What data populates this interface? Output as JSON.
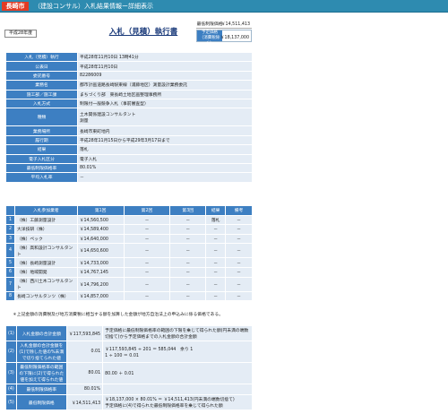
{
  "header": {
    "city": "長崎市",
    "title": "（建設コンサル）入札結果情報ー詳細表示"
  },
  "era": "平成28年度",
  "doc_title": "入札（見積）執行書",
  "min_price": {
    "label": "最低制限価格",
    "value": "￥14,511,413"
  },
  "est_price": {
    "label1": "予定価格",
    "label2": "（消費税除く）",
    "value": "￥18,137,000"
  },
  "info": [
    {
      "k": "入札（見積）執行",
      "v": "平成28年11月10日 13時41分"
    },
    {
      "k": "公表日",
      "v": "平成28年11月10日"
    },
    {
      "k": "委託番号",
      "v": "82286009"
    },
    {
      "k": "業務名",
      "v": "都市計画道路長崎駅東線（浦藤地区）測量設計業務委託"
    },
    {
      "k": "施工部／施工課",
      "v": "まちづくり部　東長崎土地区画整理事務所"
    },
    {
      "k": "入札方式",
      "v": "制限付一般競争入札（事前審査型）"
    },
    {
      "k": "種類",
      "v": "土木関係建設コンサルタント",
      "v2": "測量"
    },
    {
      "k": "業務場所",
      "v": "長崎市東町地内"
    },
    {
      "k": "履行期",
      "v": "平成28年11月15日から平成29年3月17日まで"
    },
    {
      "k": "結果",
      "v": "落札"
    },
    {
      "k": "電子入札区分",
      "v": "電子入札"
    },
    {
      "k": "最低制限価格率",
      "v": "80.01%"
    },
    {
      "k": "平均入札率",
      "v": "－"
    }
  ],
  "bid_headers": [
    "入札参加業者",
    "第1回",
    "第2回",
    "第3回",
    "結果",
    "備考"
  ],
  "bidders": [
    {
      "no": "1",
      "name": "（株）工藤測量設計",
      "r1": "￥14,560,500",
      "r2": "－",
      "r3": "－",
      "res": "落札",
      "memo": "－"
    },
    {
      "no": "2",
      "name": "大洋技研（株）",
      "r1": "￥14,589,400",
      "r2": "－",
      "r3": "－",
      "res": "－",
      "memo": "－"
    },
    {
      "no": "3",
      "name": "（株）ペック",
      "r1": "￥14,640,000",
      "r2": "－",
      "r3": "－",
      "res": "－",
      "memo": "－"
    },
    {
      "no": "4",
      "name": "（株）高和設計コンサルタント",
      "r1": "￥14,650,600",
      "r2": "－",
      "r3": "－",
      "res": "－",
      "memo": "－"
    },
    {
      "no": "5",
      "name": "（株）長崎測量設計",
      "r1": "￥14,733,000",
      "r2": "－",
      "r3": "－",
      "res": "－",
      "memo": "－"
    },
    {
      "no": "6",
      "name": "（株）地域開発",
      "r1": "￥14,767,145",
      "r2": "－",
      "r3": "－",
      "res": "－",
      "memo": "－"
    },
    {
      "no": "7",
      "name": "（株）西川土木コンサルタント",
      "r1": "￥14,796,200",
      "r2": "－",
      "r3": "－",
      "res": "－",
      "memo": "－"
    },
    {
      "no": "8",
      "name": "長崎コンサルタンツ（株）",
      "r1": "￥14,857,000",
      "r2": "－",
      "r3": "－",
      "res": "－",
      "memo": "－"
    }
  ],
  "note": "＊上記金額の消費税及び地方消費税に相当する額を加算した金額が地方自治法上の申込みに係る価格である。",
  "calc": [
    {
      "no": "(1)",
      "k": "入札金額の合計金額",
      "v": "￥117,593,845",
      "v2": "",
      "d": "予定価格に最低制限価格率の範囲の下限を乗じて得られた額(円未満の端数切捨て)から予定価格までの入札金額の合計金額"
    },
    {
      "no": "(2)",
      "k": "入札金額の合計金額を(1)で除した値の%未満で切り捨てられた値",
      "v": "0.01",
      "v2": "",
      "d": "￥117,593,845 ÷ 201 ＝ 585,044　余り 1\n1 ÷ 100 ＝ 0.01"
    },
    {
      "no": "(3)",
      "k": "最低制限価格率の範囲の下限に(2)で得られた値を加えて得られた値",
      "v": "80.01",
      "v2": "",
      "d": "80.00 ＋ 0.01"
    },
    {
      "no": "(4)",
      "k": "最低制限価格率",
      "v": "80.01%",
      "v2": "",
      "d": ""
    },
    {
      "no": "(5)",
      "k": "最低制限価格",
      "v": "￥14,511,413",
      "v2": "",
      "d": "￥18,137,000 × 80.01% ＝ ￥14,511,413(円未満の端数切捨て)\n予定価格に(4)で得られた最低制限価格率を乗じて得られた額"
    }
  ]
}
